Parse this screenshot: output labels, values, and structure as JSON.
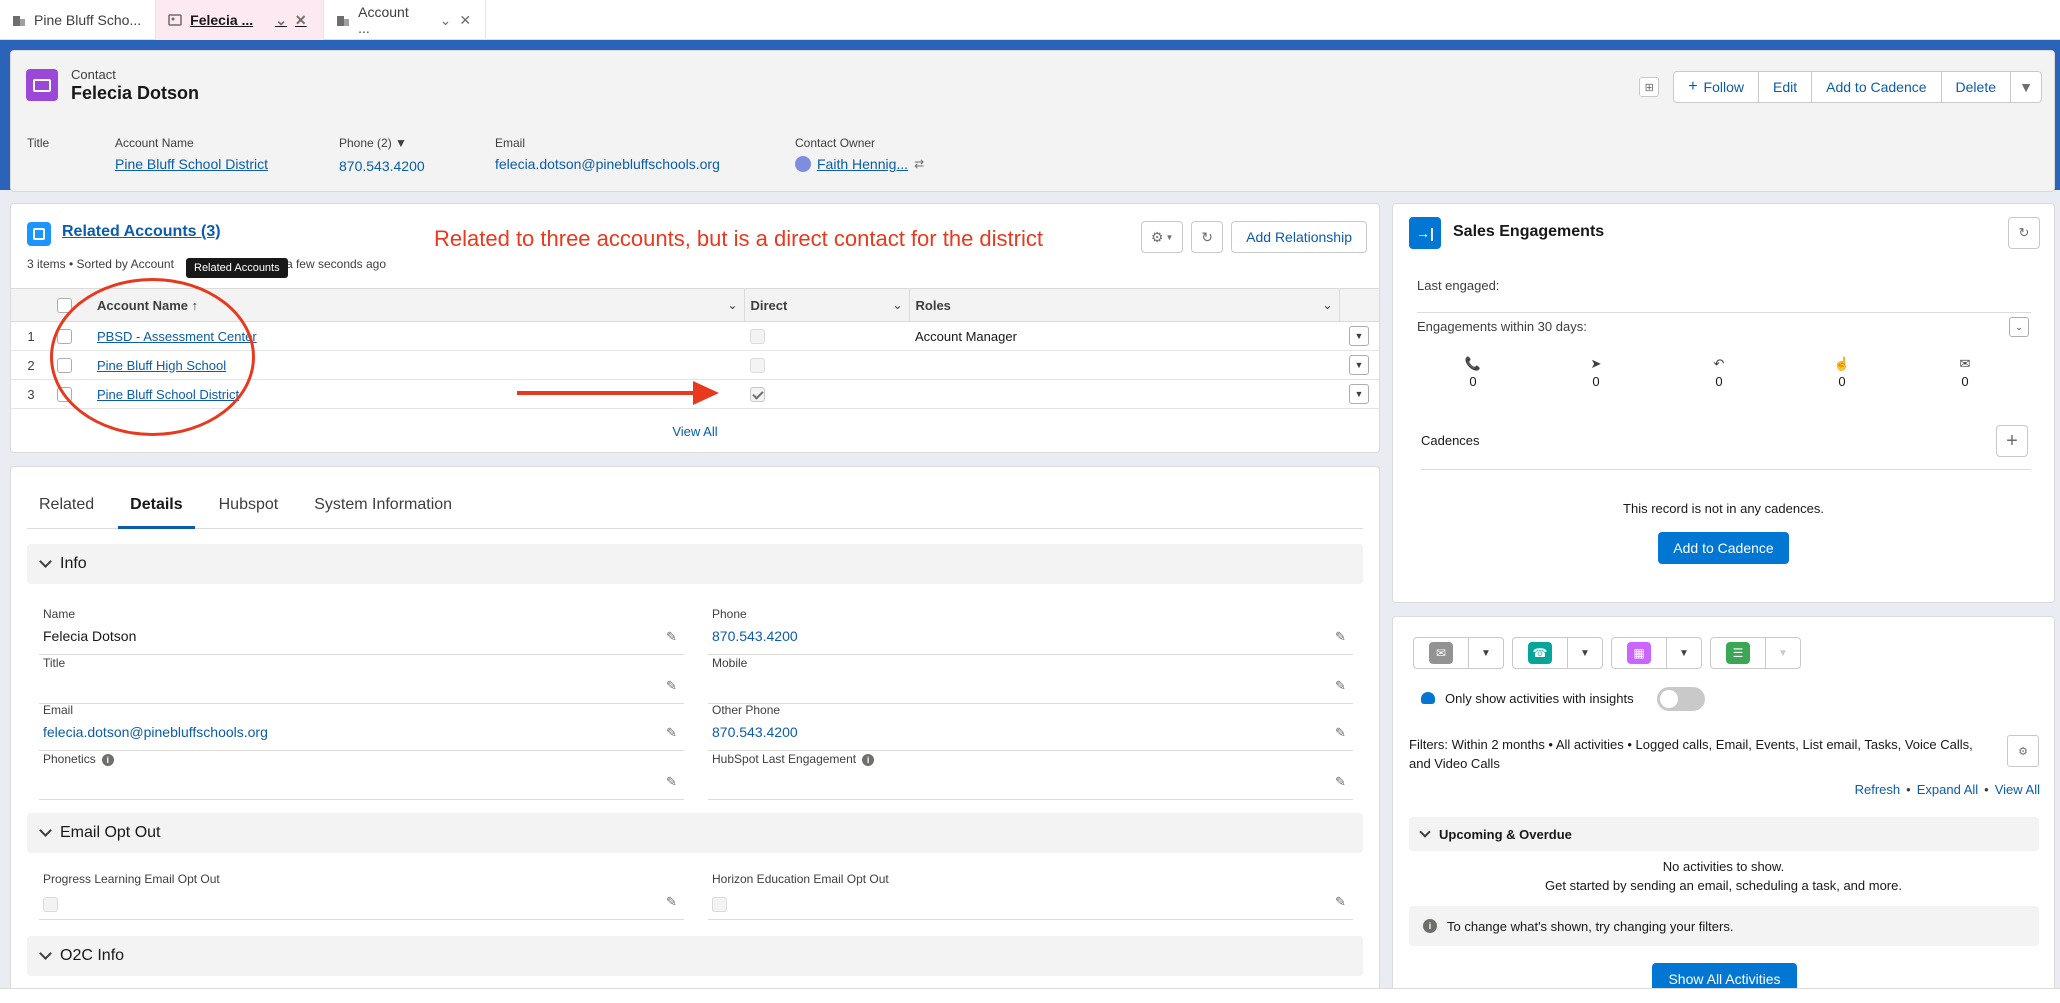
{
  "tabs": [
    {
      "label": "Pine Bluff Scho..."
    },
    {
      "label": "Felecia ..."
    },
    {
      "label": "Account ..."
    }
  ],
  "header": {
    "object_type": "Contact",
    "name": "Felecia Dotson",
    "buttons": {
      "follow": "Follow",
      "edit": "Edit",
      "add_to_cadence": "Add to Cadence",
      "delete": "Delete"
    },
    "fields": {
      "title_label": "Title",
      "account_label": "Account Name",
      "account_value": "Pine Bluff School District",
      "phone_label": "Phone (2)",
      "phone_value": "870.543.4200",
      "email_label": "Email",
      "email_value": "felecia.dotson@pinebluffschools.org",
      "owner_label": "Contact Owner",
      "owner_value": "Faith Hennig..."
    }
  },
  "related_accounts": {
    "title": "Related Accounts (3)",
    "subtitle_left": "3 items • Sorted by Account",
    "subtitle_right": "a few seconds ago",
    "tooltip": "Related Accounts",
    "annotation": "Related to three accounts, but is a direct contact for the district",
    "add_button": "Add Relationship",
    "columns": {
      "account": "Account Name ↑",
      "direct": "Direct",
      "roles": "Roles"
    },
    "rows": [
      {
        "num": "1",
        "account": "PBSD - Assessment Center",
        "roles": "Account Manager"
      },
      {
        "num": "2",
        "account": "Pine Bluff High School",
        "roles": ""
      },
      {
        "num": "3",
        "account": "Pine Bluff School District",
        "roles": ""
      }
    ],
    "view_all": "View All"
  },
  "details": {
    "tabs": [
      "Related",
      "Details",
      "Hubspot",
      "System Information"
    ],
    "sections": {
      "info": "Info",
      "opt_out": "Email Opt Out",
      "o2c": "O2C Info"
    },
    "fields": {
      "name_label": "Name",
      "name_value": "Felecia Dotson",
      "phone_label": "Phone",
      "phone_value": "870.543.4200",
      "title_label": "Title",
      "mobile_label": "Mobile",
      "email_label": "Email",
      "email_value": "felecia.dotson@pinebluffschools.org",
      "other_phone_label": "Other Phone",
      "other_phone_value": "870.543.4200",
      "phonetics_label": "Phonetics",
      "hubspot_label": "HubSpot Last Engagement",
      "progress_label": "Progress Learning Email Opt Out",
      "horizon_label": "Horizon Education Email Opt Out"
    }
  },
  "sales_engagements": {
    "title": "Sales Engagements",
    "last_engaged": "Last engaged:",
    "within_30": "Engagements within 30 days:",
    "counts": [
      "0",
      "0",
      "0",
      "0",
      "0"
    ],
    "cadences": "Cadences",
    "none_msg": "This record is not in any cadences.",
    "add_button": "Add to Cadence"
  },
  "activity": {
    "insights": "Only show activities with insights",
    "filters": "Filters: Within 2 months • All activities • Logged calls, Email, Events, List email, Tasks, Voice Calls, and Video Calls",
    "links": {
      "refresh": "Refresh",
      "expand": "Expand All",
      "view": "View All"
    },
    "upcoming": "Upcoming & Overdue",
    "no_activities": "No activities to show.",
    "get_started": "Get started by sending an email, scheduling a task, and more.",
    "hint": "To change what's shown, try changing your filters.",
    "show_all": "Show All Activities"
  },
  "colors": {
    "brand": "#0176d3",
    "link": "#0b5cab",
    "annotation": "#e8391f",
    "contact_icon": "#9b48d8"
  }
}
